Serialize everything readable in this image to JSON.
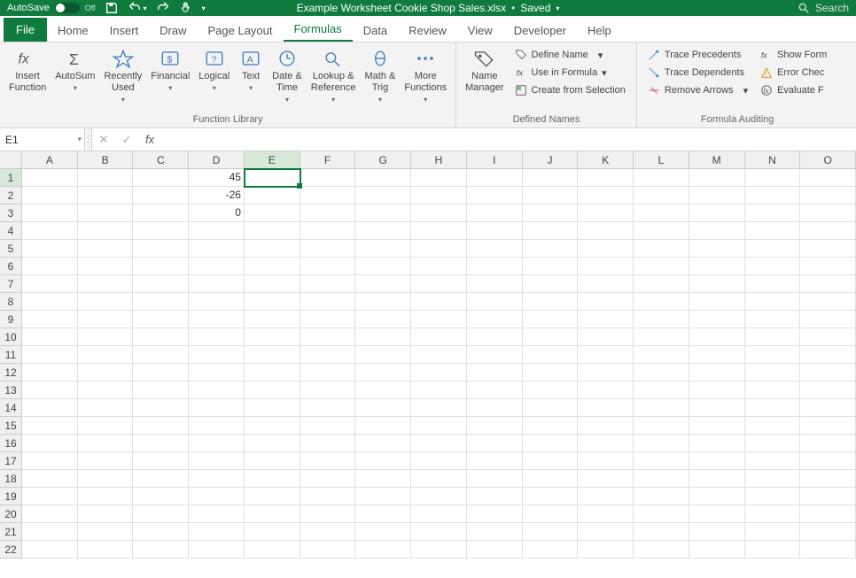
{
  "titlebar": {
    "autosave_label": "AutoSave",
    "autosave_state": "Off",
    "filename": "Example Worksheet Cookie Shop Sales.xlsx",
    "save_status": "Saved",
    "search_placeholder": "Search"
  },
  "tabs": {
    "file": "File",
    "items": [
      "Home",
      "Insert",
      "Draw",
      "Page Layout",
      "Formulas",
      "Data",
      "Review",
      "View",
      "Developer",
      "Help"
    ],
    "active": "Formulas"
  },
  "ribbon": {
    "function_library": {
      "label": "Function Library",
      "insert_function": "Insert\nFunction",
      "autosum": "AutoSum",
      "recently_used": "Recently\nUsed",
      "financial": "Financial",
      "logical": "Logical",
      "text": "Text",
      "date_time": "Date &\nTime",
      "lookup_reference": "Lookup &\nReference",
      "math_trig": "Math &\nTrig",
      "more_functions": "More\nFunctions"
    },
    "defined_names": {
      "label": "Defined Names",
      "name_manager": "Name\nManager",
      "define_name": "Define Name",
      "use_in_formula": "Use in Formula",
      "create_from_selection": "Create from Selection"
    },
    "formula_auditing": {
      "label": "Formula Auditing",
      "trace_precedents": "Trace Precedents",
      "trace_dependents": "Trace Dependents",
      "remove_arrows": "Remove Arrows",
      "show_formulas": "Show Form",
      "error_checking": "Error Chec",
      "evaluate_formula": "Evaluate F"
    }
  },
  "name_box": "E1",
  "formula_value": "",
  "columns": [
    "A",
    "B",
    "C",
    "D",
    "E",
    "F",
    "G",
    "H",
    "I",
    "J",
    "K",
    "L",
    "M",
    "N",
    "O"
  ],
  "rows": [
    1,
    2,
    3,
    4,
    5,
    6,
    7,
    8,
    9,
    10,
    11,
    12,
    13,
    14,
    15,
    16,
    17,
    18,
    19,
    20,
    21,
    22
  ],
  "selected_col_index": 4,
  "selected_row_index": 0,
  "cell_data": {
    "D1": "45",
    "D2": "-26",
    "D3": "0"
  }
}
